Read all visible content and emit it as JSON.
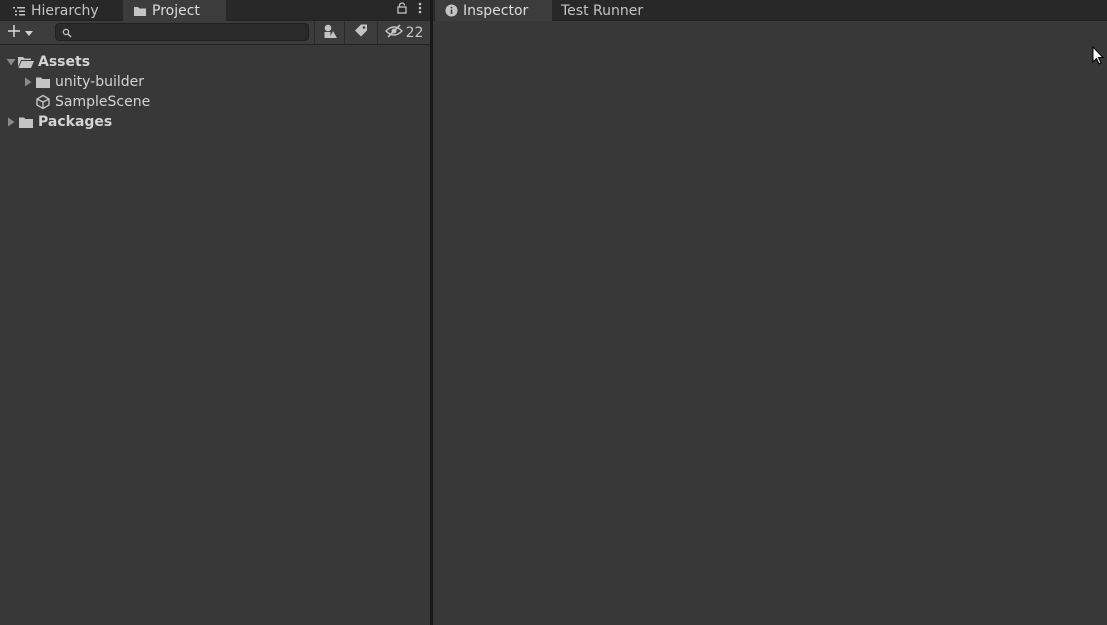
{
  "left_tabs": [
    {
      "label": "Hierarchy",
      "icon": "hierarchy-list-icon",
      "active": false
    },
    {
      "label": "Project",
      "icon": "folder-icon",
      "active": true
    }
  ],
  "right_tabs": [
    {
      "label": "Inspector",
      "icon": "info-icon",
      "active": true
    },
    {
      "label": "Test Runner",
      "active": false
    }
  ],
  "toolbar": {
    "search_value": "",
    "hidden_count": "22"
  },
  "tree": [
    {
      "label": "Assets",
      "bold": true,
      "expanded": true,
      "icon": "open-folder-icon",
      "depth": 0
    },
    {
      "label": "unity-builder",
      "bold": false,
      "expanded": false,
      "icon": "folder-icon",
      "depth": 1
    },
    {
      "label": "SampleScene",
      "bold": false,
      "icon": "unity-scene-icon",
      "depth": 1
    },
    {
      "label": "Packages",
      "bold": true,
      "expanded": false,
      "icon": "folder-icon",
      "depth": 0
    }
  ],
  "colors": {
    "background": "#383838",
    "tabbar": "#282828",
    "active_tab": "#3c3c3c",
    "text": "#d2d2d2"
  }
}
